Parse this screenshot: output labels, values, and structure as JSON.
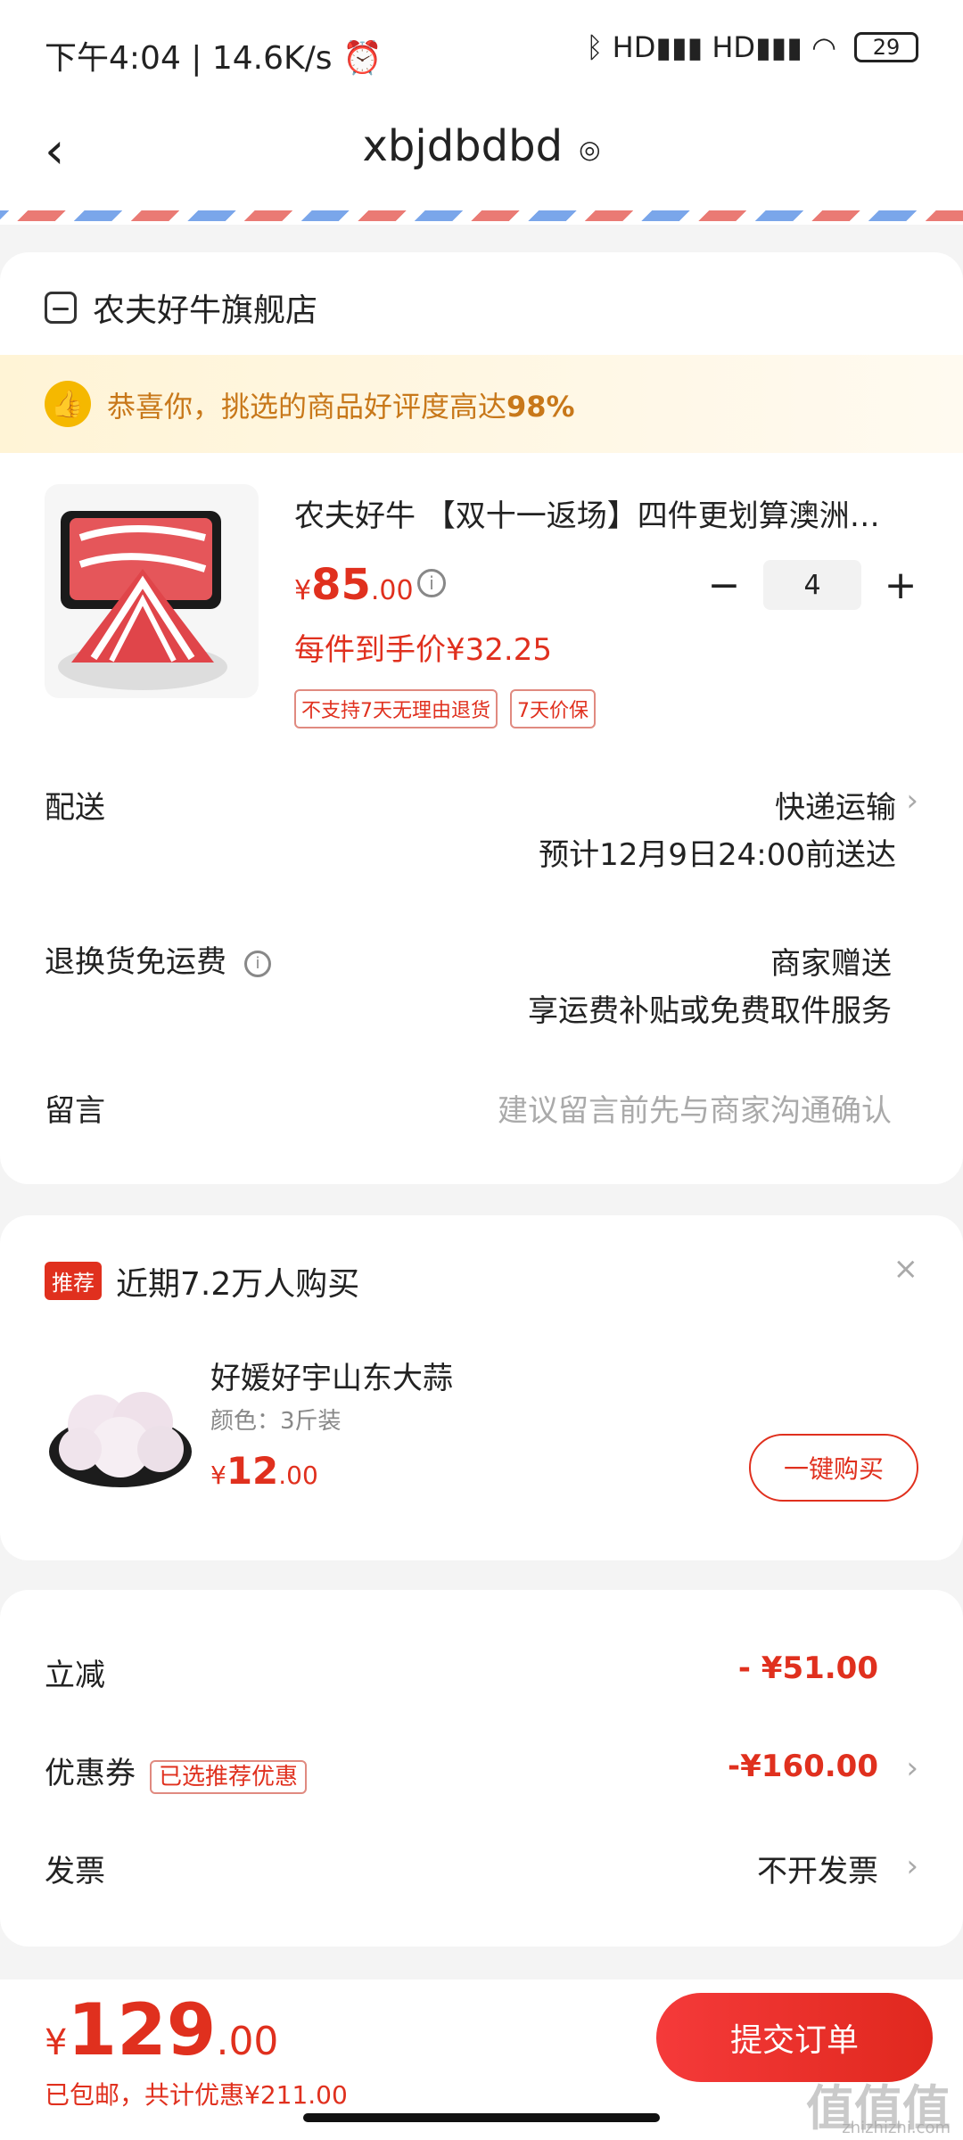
{
  "status_bar": {
    "time_speed": "下午4:04 | 14.6K/s ⏰",
    "network": "ᛒ HD▮▮▮ HD▮▮▮ ◠",
    "battery": "29"
  },
  "nav": {
    "back": "‹",
    "title": "xbjdbdbd",
    "location_icon": "◎"
  },
  "store": {
    "name": "农夫好牛旗舰店"
  },
  "banner": {
    "text_prefix": "恭喜你，挑选的商品好评度高达",
    "percent": "98%"
  },
  "product": {
    "title": "农夫好牛 【双十一返场】四件更划算澳洲…",
    "price_symbol": "¥",
    "price_int": "85",
    "price_dec": ".00",
    "quantity": "4",
    "minus": "−",
    "plus": "+",
    "unit_price": "每件到手价¥32.25",
    "tags": [
      "不支持7天无理由退货",
      "7天价保"
    ]
  },
  "delivery": {
    "label": "配送",
    "method": "快递运输",
    "eta": "预计12月9日24:00前送达"
  },
  "return": {
    "label": "退换货免运费",
    "value": "商家赠送",
    "desc": "享运费补贴或免费取件服务"
  },
  "message": {
    "label": "留言",
    "placeholder": "建议留言前先与商家沟通确认"
  },
  "recommend": {
    "badge": "推荐",
    "title": "近期7.2万人购买",
    "close": "×",
    "item_name": "好媛好宇山东大蒜",
    "item_spec": "颜色：3斤装",
    "price_symbol": "¥",
    "price_int": "12",
    "price_dec": ".00",
    "buy_label": "一键购买"
  },
  "summary": {
    "discount_label": "立减",
    "discount_value": "- ¥51.00",
    "coupon_label": "优惠券",
    "coupon_tag": "已选推荐优惠",
    "coupon_value": "-¥160.00",
    "invoice_label": "发票",
    "invoice_value": "不开发票"
  },
  "bottom": {
    "total_symbol": "¥",
    "total_int": "129",
    "total_dec": ".00",
    "note": "已包邮，共计优惠¥211.00",
    "submit": "提交订单"
  },
  "watermark": {
    "main": "值值值",
    "sub": "zhizhizhi.com"
  },
  "colors": {
    "accent": "#e0301e",
    "banner_text": "#c8781a",
    "banner_bg": "#fff4d6"
  }
}
